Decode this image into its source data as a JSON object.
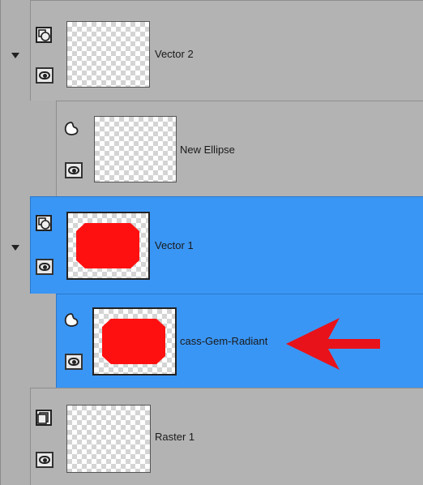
{
  "layers": [
    {
      "name": "Vector 2",
      "kind": "vector-group",
      "selected": false,
      "expanded": true,
      "visible": true
    },
    {
      "name": "New Ellipse",
      "kind": "vector-object",
      "selected": false,
      "visible": true
    },
    {
      "name": "Vector 1",
      "kind": "vector-group",
      "selected": true,
      "expanded": true,
      "visible": true
    },
    {
      "name": "cass-Gem-Radiant",
      "kind": "vector-object",
      "selected": true,
      "visible": true
    },
    {
      "name": "Raster 1",
      "kind": "raster",
      "selected": false,
      "visible": true
    }
  ],
  "colors": {
    "selected_row": "#3a96f5",
    "normal_row": "#b3b3b3",
    "shape_fill": "#ff1010",
    "annotation_arrow": "#e8121a"
  },
  "icons": {
    "expander": "triangle-down-icon",
    "vector_layer": "vector-layer-icon",
    "vector_object": "vector-object-icon",
    "raster_layer": "raster-layer-icon",
    "visibility": "eye-icon"
  }
}
